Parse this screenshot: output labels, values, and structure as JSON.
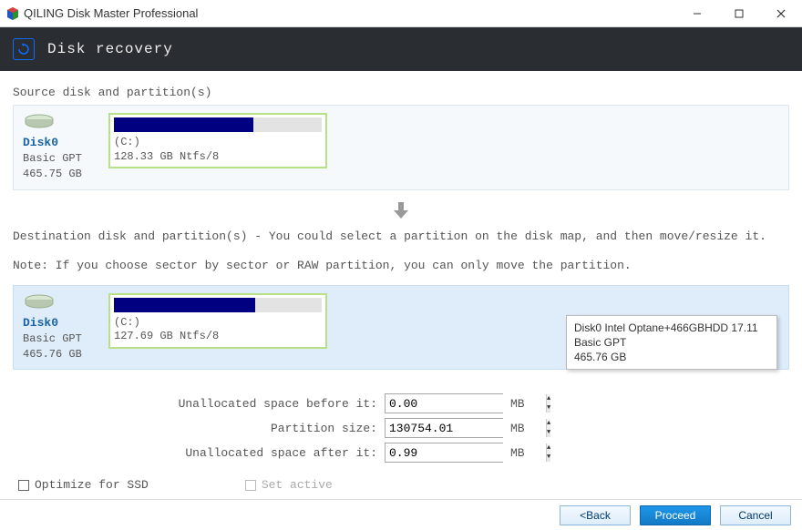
{
  "window": {
    "title": "QILING Disk Master Professional"
  },
  "header": {
    "title": "Disk recovery"
  },
  "source": {
    "label": "Source disk and partition(s)",
    "disk": {
      "name": "Disk0",
      "type": "Basic GPT",
      "size": "465.75 GB"
    },
    "partition": {
      "letter": "(C:)",
      "desc": "128.33 GB Ntfs/8",
      "fill_percent": 67
    }
  },
  "destination": {
    "label": "Destination disk and partition(s) - You could select a partition on the disk map, and then move/resize it.",
    "note": "Note: If you choose sector by sector or RAW partition, you can only move the partition.",
    "disk": {
      "name": "Disk0",
      "type": "Basic GPT",
      "size": "465.76 GB"
    },
    "partition": {
      "letter": "(C:)",
      "desc": "127.69 GB Ntfs/8",
      "fill_percent": 68
    },
    "tooltip": {
      "line1": "Disk0 Intel Optane+466GBHDD 17.11",
      "line2": "Basic GPT",
      "line3": "465.76 GB"
    }
  },
  "inputs": {
    "unalloc_before_label": "Unallocated space before it:",
    "unalloc_before_value": "0.00",
    "part_size_label": "Partition size:",
    "part_size_value": "130754.01",
    "unalloc_after_label": "Unallocated space after it:",
    "unalloc_after_value": "0.99",
    "unit": "MB"
  },
  "options": {
    "optimize_ssd": "Optimize for SSD",
    "set_active": "Set active"
  },
  "buttons": {
    "back": "<Back",
    "proceed": "Proceed",
    "cancel": "Cancel"
  }
}
